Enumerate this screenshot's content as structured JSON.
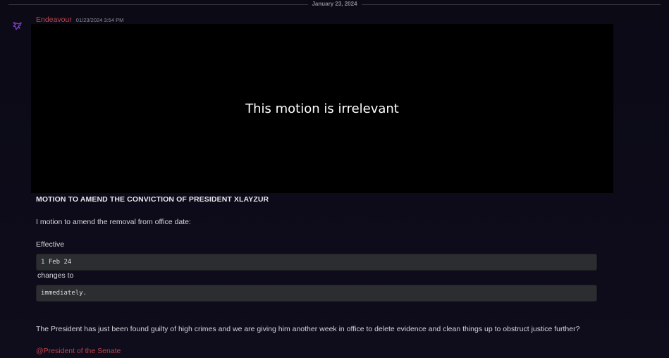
{
  "date_divider": "January 23, 2024",
  "message": {
    "author": "Endeavour",
    "timestamp": "01/23/2024 3:54 PM",
    "author_color": "#c0444f",
    "avatar_icon": "bird-icon",
    "image_caption": "This motion is irrelevant",
    "heading": "MOTION TO AMEND THE CONVICTION OF PRESIDENT XLAYZUR",
    "line1": "I motion to amend the removal from office date:",
    "line2": "Effective",
    "code1": "1 Feb 24",
    "line3": "changes to",
    "code2": "immediately.",
    "line4": "The President has just been found guilty of high crimes and we are giving him another week in office to delete evidence and clean things up to obstruct justice further?",
    "mention": "@President of the Senate"
  }
}
